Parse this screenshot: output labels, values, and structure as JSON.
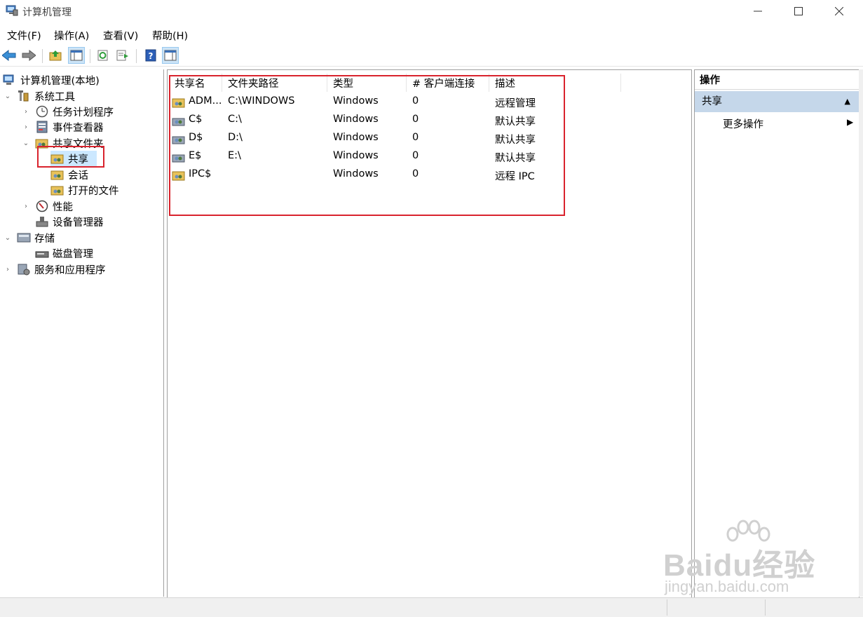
{
  "window": {
    "title": "计算机管理"
  },
  "menu": [
    "文件(F)",
    "操作(A)",
    "查看(V)",
    "帮助(H)"
  ],
  "tree": {
    "root": "计算机管理(本地)",
    "system_tools": "系统工具",
    "task_scheduler": "任务计划程序",
    "event_viewer": "事件查看器",
    "shared_folders": "共享文件夹",
    "shares": "共享",
    "sessions": "会话",
    "open_files": "打开的文件",
    "performance": "性能",
    "device_manager": "设备管理器",
    "storage": "存储",
    "disk_management": "磁盘管理",
    "services_apps": "服务和应用程序"
  },
  "table": {
    "columns": [
      "共享名",
      "文件夹路径",
      "类型",
      "# 客户端连接",
      "描述"
    ],
    "rows": [
      {
        "name": "ADM...",
        "path": "C:\\WINDOWS",
        "type": "Windows",
        "clients": "0",
        "desc": "远程管理"
      },
      {
        "name": "C$",
        "path": "C:\\",
        "type": "Windows",
        "clients": "0",
        "desc": "默认共享"
      },
      {
        "name": "D$",
        "path": "D:\\",
        "type": "Windows",
        "clients": "0",
        "desc": "默认共享"
      },
      {
        "name": "E$",
        "path": "E:\\",
        "type": "Windows",
        "clients": "0",
        "desc": "默认共享"
      },
      {
        "name": "IPC$",
        "path": "",
        "type": "Windows",
        "clients": "0",
        "desc": "远程 IPC"
      }
    ]
  },
  "actions": {
    "title": "操作",
    "section": "共享",
    "more": "更多操作"
  },
  "watermark": {
    "main": "Baidu经验",
    "sub": "jingyan.baidu.com"
  },
  "colors": {
    "selection": "#cce8ff",
    "highlight_box": "#d9232d",
    "action_header": "#c5d7ea"
  }
}
